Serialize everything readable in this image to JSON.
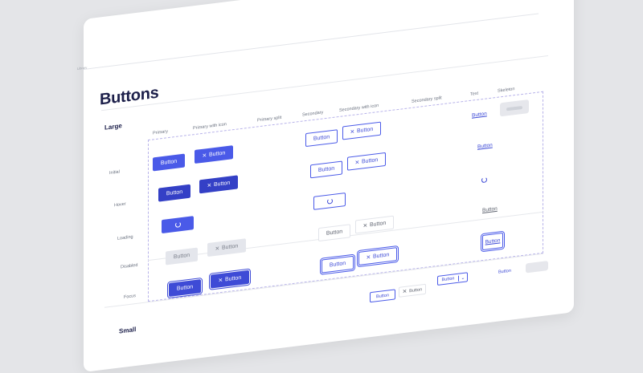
{
  "page": {
    "tag": "Library",
    "title": "Buttons"
  },
  "sections": {
    "large": "Large",
    "small": "Small"
  },
  "columns": {
    "primary": "Primary",
    "primary_icon": "Primary with icon",
    "primary_split": "Primary split",
    "secondary": "Secondary",
    "secondary_icon": "Secondary with icon",
    "secondary_split": "Secondary split",
    "text": "Text",
    "skeleton": "Skeleton"
  },
  "rows": {
    "initial": "Initial",
    "hover": "Hover",
    "loading": "Loading",
    "disabled": "Disabled",
    "focus": "Focus"
  },
  "button": {
    "label": "Button"
  },
  "icons": {
    "close": "close-icon",
    "spinner": "spinner-icon",
    "chevron": "chevron-down-icon"
  },
  "colors": {
    "primary": "#4a5ae8",
    "primary_hover": "#3440c6",
    "disabled": "#e4e6ec",
    "text_dark": "#1c1f4a"
  }
}
